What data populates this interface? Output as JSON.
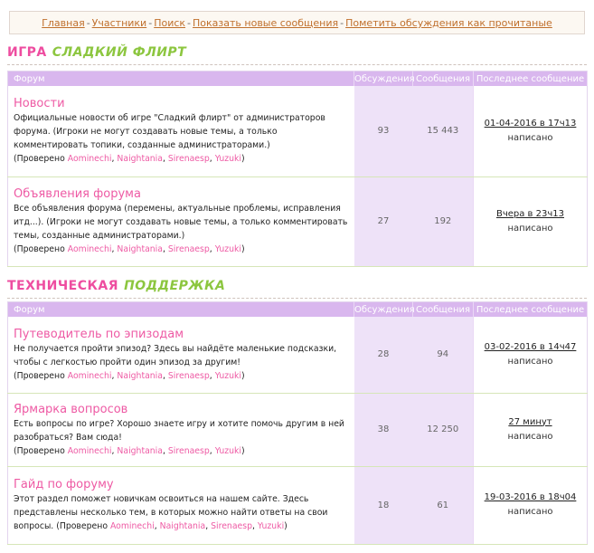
{
  "nav": {
    "links": [
      "Главная",
      "Участники",
      "Поиск",
      "Показать новые сообщения",
      "Пометить обсуждения как прочитаные"
    ],
    "separator": "-"
  },
  "categories": [
    {
      "title_word1": "Игра",
      "title_word2": "Сладкий флирт",
      "headers": {
        "forum": "Форум",
        "topics": "Обсуждения",
        "posts": "Сообщения",
        "last": "Последнее сообщение"
      },
      "forums": [
        {
          "title": "Новости",
          "description": "Официальные новости об игре \"Сладкий флирт\" от администраторов форума. (Игроки не могут создавать новые темы, а только комментировать топики, созданные администраторами.)",
          "checked_prefix": "(Проверено",
          "moderators": [
            "Aominechi",
            "Naightania",
            "Sirenaesp",
            "Yuzuki"
          ],
          "checked_suffix": ")",
          "topics": "93",
          "posts": "15 443",
          "last_date": "01-04-2016 в 17ч13",
          "last_by": "написано"
        },
        {
          "title": "Объявления форума",
          "description": "Все объявления форума (перемены, актуальные проблемы, исправления итд...). (Игроки не могут создавать новые темы, а только комментировать темы, созданные администраторами.)",
          "checked_prefix": "(Проверено",
          "moderators": [
            "Aominechi",
            "Naightania",
            "Sirenaesp",
            "Yuzuki"
          ],
          "checked_suffix": ")",
          "topics": "27",
          "posts": "192",
          "last_date": "Вчера в 23ч13",
          "last_by": "написано"
        }
      ]
    },
    {
      "title_word1": "Техническая",
      "title_word2": "поддержка",
      "headers": {
        "forum": "Форум",
        "topics": "Обсуждения",
        "posts": "Сообщения",
        "last": "Последнее сообщение"
      },
      "forums": [
        {
          "title": "Путеводитель по эпизодам",
          "description": "Не получается пройти эпизод? Здесь вы найдёте маленькие подсказки, чтобы с легкостью пройти один эпизод за другим!",
          "checked_prefix": "(Проверено",
          "moderators": [
            "Aominechi",
            "Naightania",
            "Sirenaesp",
            "Yuzuki"
          ],
          "checked_suffix": ")",
          "topics": "28",
          "posts": "94",
          "last_date": "03-02-2016 в 14ч47",
          "last_by": "написано"
        },
        {
          "title": "Ярмарка вопросов",
          "description": "Есть вопросы по игре? Хорошо знаете игру и хотите помочь другим в ней разобраться? Вам сюда!",
          "checked_prefix": "(Проверено",
          "moderators": [
            "Aominechi",
            "Naightania",
            "Sirenaesp",
            "Yuzuki"
          ],
          "checked_suffix": ")",
          "topics": "38",
          "posts": "12 250",
          "last_date": "27 минут",
          "last_by": "написано"
        },
        {
          "title": "Гайд по форуму",
          "description": "Этот раздел поможет новичкам освоиться на нашем сайте. Здесь представлены несколько тем, в которых можно найти ответы на свои вопросы.",
          "checked_prefix": "(Проверено",
          "moderators": [
            "Aominechi",
            "Naightania",
            "Sirenaesp",
            "Yuzuki"
          ],
          "checked_suffix": ")",
          "topics": "18",
          "posts": "61",
          "last_date": "19-03-2016 в 18ч04",
          "last_by": "написано"
        }
      ]
    }
  ]
}
